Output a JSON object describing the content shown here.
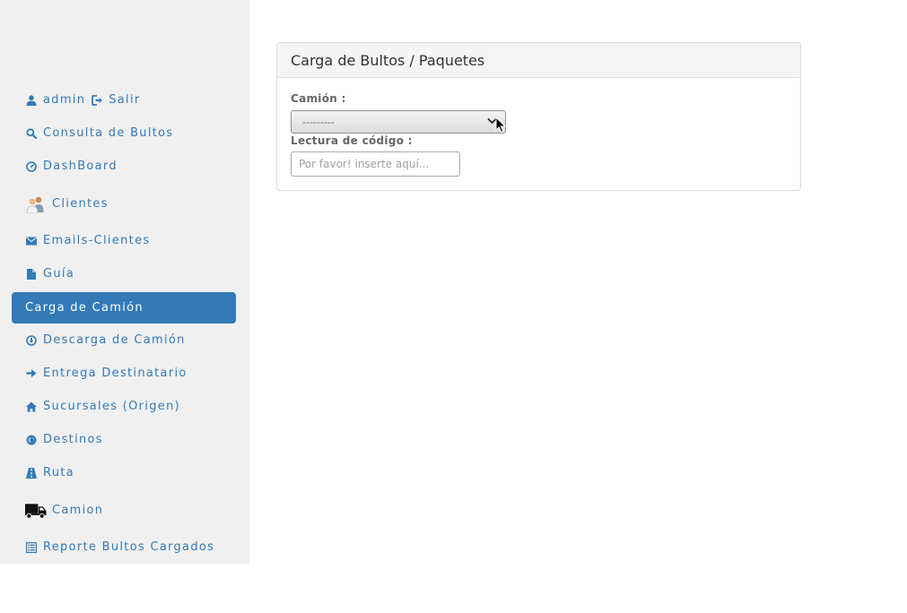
{
  "sidebar": {
    "user": {
      "name": "admin",
      "logout_label": "Salir"
    },
    "items": [
      {
        "label": "Consulta de Bultos",
        "icon": "search-icon"
      },
      {
        "label": "DashBoard",
        "icon": "dashboard-icon"
      },
      {
        "label": "Clientes",
        "icon": "clients-icon"
      },
      {
        "label": "Emails-Clientes",
        "icon": "envelope-icon"
      },
      {
        "label": "Guía",
        "icon": "file-icon"
      },
      {
        "label": "Carga de Camión",
        "icon": "",
        "active": true
      },
      {
        "label": "Descarga de Camión",
        "icon": "download-circle-icon"
      },
      {
        "label": "Entrega Destinatario",
        "icon": "arrow-right-icon"
      },
      {
        "label": "Sucursales (Origen)",
        "icon": "home-icon"
      },
      {
        "label": "Destinos",
        "icon": "globe-icon"
      },
      {
        "label": "Ruta",
        "icon": "road-icon"
      },
      {
        "label": "Camion",
        "icon": "truck-icon"
      },
      {
        "label": "Reporte Bultos Cargados",
        "icon": "list-icon"
      }
    ]
  },
  "panel": {
    "title": "Carga de Bultos / Paquetes",
    "truck_label": "Camión :",
    "truck_select_value": "---------",
    "code_label": "Lectura de código :",
    "code_placeholder": "Por favor! inserte aquí..."
  },
  "colors": {
    "sidebar_bg": "#f0f0f0",
    "link": "#337ab7",
    "active_bg": "#337ab7"
  }
}
